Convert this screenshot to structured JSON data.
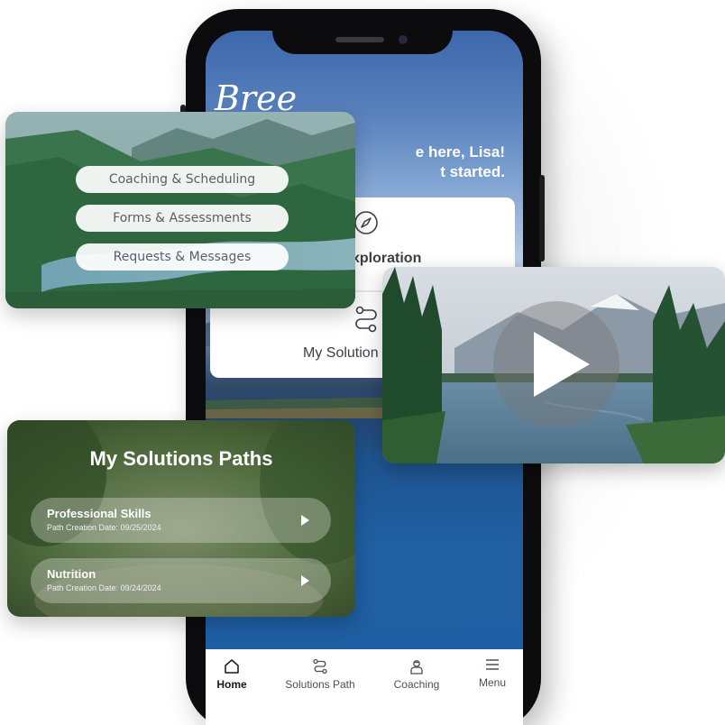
{
  "app": {
    "logo_text": "Bree",
    "welcome_line1": "e here, Lisa!",
    "welcome_line2": "t started."
  },
  "home_card": {
    "exploration_label": "xploration",
    "solutions_label": "My Solution",
    "icons": [
      "compass-icon",
      "route-icon"
    ]
  },
  "bottom_nav": {
    "items": [
      {
        "label": "Home",
        "icon": "home-icon",
        "active": true
      },
      {
        "label": "Solutions Path",
        "icon": "route-icon",
        "active": false
      },
      {
        "label": "Coaching",
        "icon": "coach-icon",
        "active": false
      },
      {
        "label": "Menu",
        "icon": "hamburger-icon",
        "active": false
      }
    ]
  },
  "menu_card": {
    "items": [
      {
        "label": "Coaching & Scheduling"
      },
      {
        "label": "Forms & Assessments"
      },
      {
        "label": "Requests & Messages"
      }
    ]
  },
  "video_card": {
    "play_icon": "play-icon"
  },
  "paths_card": {
    "title": "My Solutions Paths",
    "paths": [
      {
        "name": "Professional Skills",
        "date": "Path Creation Date: 09/25/2024"
      },
      {
        "name": "Nutrition",
        "date": "Path Creation Date: 09/24/2024"
      }
    ]
  },
  "colors": {
    "phone_frame": "#0c0c0e",
    "screen_sky": "#3c67ab",
    "lake": "#1e5ea3",
    "card_text": "#3b3f48",
    "pill_bg": "#ffffff"
  }
}
